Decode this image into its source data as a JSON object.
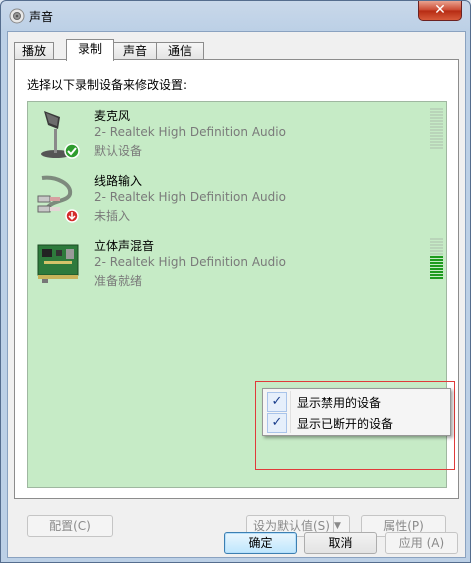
{
  "window": {
    "title": "声音",
    "close_label": "✕"
  },
  "tabs": [
    {
      "label": "播放",
      "active": false
    },
    {
      "label": "录制",
      "active": true
    },
    {
      "label": "声音",
      "active": false
    },
    {
      "label": "通信",
      "active": false
    }
  ],
  "instruction": "选择以下录制设备来修改设置:",
  "devices": [
    {
      "name": "麦克风",
      "description": "2- Realtek High Definition Audio",
      "status": "默认设备",
      "icon": "microphone-icon",
      "badge": "default-check-icon",
      "level": 0
    },
    {
      "name": "线路输入",
      "description": "2- Realtek High Definition Audio",
      "status": "未插入",
      "icon": "line-in-cable-icon",
      "badge": "unplugged-arrow-icon",
      "level": null
    },
    {
      "name": "立体声混音",
      "description": "2- Realtek High Definition Audio",
      "status": "准备就绪",
      "icon": "sound-card-icon",
      "badge": null,
      "level": 0.6
    }
  ],
  "context_menu": {
    "items": [
      {
        "label": "显示禁用的设备",
        "checked": true
      },
      {
        "label": "显示已断开的设备",
        "checked": true
      }
    ]
  },
  "panel_buttons": {
    "configure": "配置(C)",
    "set_default": "设为默认值(S)",
    "properties": "属性(P)"
  },
  "dialog_buttons": {
    "ok": "确定",
    "cancel": "取消",
    "apply": "应用 (A)"
  },
  "colors": {
    "list_background": "#c6ebc6",
    "highlight_box": "#e03a3a",
    "meter_on": "#1e9b1e"
  }
}
